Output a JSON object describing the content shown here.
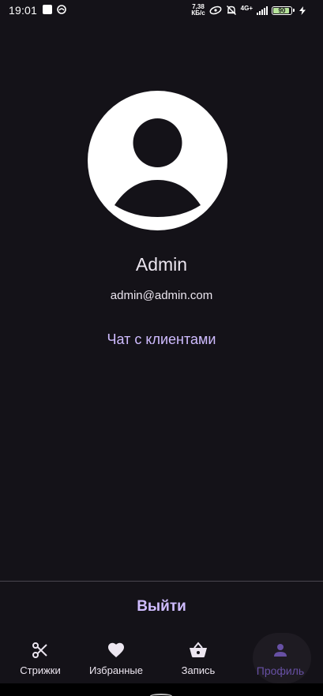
{
  "status_bar": {
    "time": "19:01",
    "net_speed_value": "7,38",
    "net_speed_unit": "КБ/с",
    "network_type": "4G+",
    "battery_level": "90",
    "battery_fraction": 0.9,
    "battery_color": "#b7e49b"
  },
  "profile": {
    "name": "Admin",
    "email": "admin@admin.com",
    "chat_link": "Чат с клиентами",
    "logout_label": "Выйти"
  },
  "bottom_nav": {
    "items": [
      {
        "label": "Стрижки",
        "icon": "scissors-icon",
        "active": false
      },
      {
        "label": "Избранные",
        "icon": "heart-icon",
        "active": false
      },
      {
        "label": "Запись",
        "icon": "basket-icon",
        "active": false
      },
      {
        "label": "Профиль",
        "icon": "person-icon",
        "active": true
      }
    ]
  },
  "colors": {
    "background": "#141218",
    "accent": "#cfbcff",
    "active_nav": "#6750a4",
    "text": "#ece6f0"
  }
}
